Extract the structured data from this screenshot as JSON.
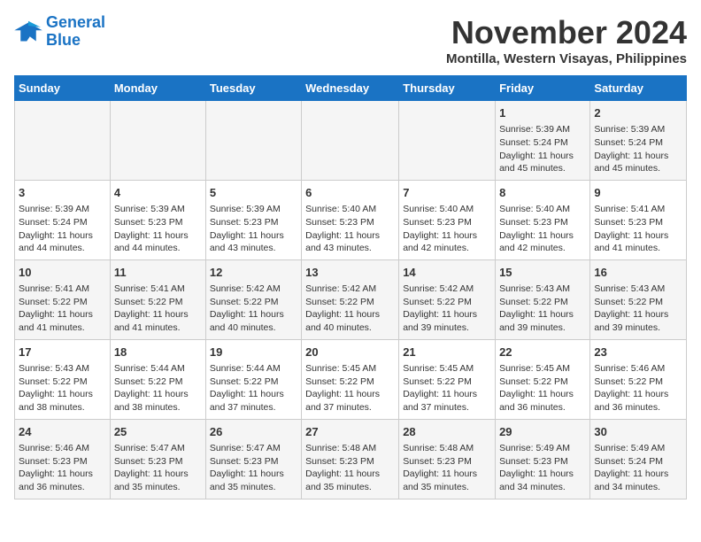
{
  "logo": {
    "line1": "General",
    "line2": "Blue"
  },
  "title": "November 2024",
  "subtitle": "Montilla, Western Visayas, Philippines",
  "headers": [
    "Sunday",
    "Monday",
    "Tuesday",
    "Wednesday",
    "Thursday",
    "Friday",
    "Saturday"
  ],
  "rows": [
    [
      {
        "day": "",
        "info": ""
      },
      {
        "day": "",
        "info": ""
      },
      {
        "day": "",
        "info": ""
      },
      {
        "day": "",
        "info": ""
      },
      {
        "day": "",
        "info": ""
      },
      {
        "day": "1",
        "info": "Sunrise: 5:39 AM\nSunset: 5:24 PM\nDaylight: 11 hours and 45 minutes."
      },
      {
        "day": "2",
        "info": "Sunrise: 5:39 AM\nSunset: 5:24 PM\nDaylight: 11 hours and 45 minutes."
      }
    ],
    [
      {
        "day": "3",
        "info": "Sunrise: 5:39 AM\nSunset: 5:24 PM\nDaylight: 11 hours and 44 minutes."
      },
      {
        "day": "4",
        "info": "Sunrise: 5:39 AM\nSunset: 5:23 PM\nDaylight: 11 hours and 44 minutes."
      },
      {
        "day": "5",
        "info": "Sunrise: 5:39 AM\nSunset: 5:23 PM\nDaylight: 11 hours and 43 minutes."
      },
      {
        "day": "6",
        "info": "Sunrise: 5:40 AM\nSunset: 5:23 PM\nDaylight: 11 hours and 43 minutes."
      },
      {
        "day": "7",
        "info": "Sunrise: 5:40 AM\nSunset: 5:23 PM\nDaylight: 11 hours and 42 minutes."
      },
      {
        "day": "8",
        "info": "Sunrise: 5:40 AM\nSunset: 5:23 PM\nDaylight: 11 hours and 42 minutes."
      },
      {
        "day": "9",
        "info": "Sunrise: 5:41 AM\nSunset: 5:23 PM\nDaylight: 11 hours and 41 minutes."
      }
    ],
    [
      {
        "day": "10",
        "info": "Sunrise: 5:41 AM\nSunset: 5:22 PM\nDaylight: 11 hours and 41 minutes."
      },
      {
        "day": "11",
        "info": "Sunrise: 5:41 AM\nSunset: 5:22 PM\nDaylight: 11 hours and 41 minutes."
      },
      {
        "day": "12",
        "info": "Sunrise: 5:42 AM\nSunset: 5:22 PM\nDaylight: 11 hours and 40 minutes."
      },
      {
        "day": "13",
        "info": "Sunrise: 5:42 AM\nSunset: 5:22 PM\nDaylight: 11 hours and 40 minutes."
      },
      {
        "day": "14",
        "info": "Sunrise: 5:42 AM\nSunset: 5:22 PM\nDaylight: 11 hours and 39 minutes."
      },
      {
        "day": "15",
        "info": "Sunrise: 5:43 AM\nSunset: 5:22 PM\nDaylight: 11 hours and 39 minutes."
      },
      {
        "day": "16",
        "info": "Sunrise: 5:43 AM\nSunset: 5:22 PM\nDaylight: 11 hours and 39 minutes."
      }
    ],
    [
      {
        "day": "17",
        "info": "Sunrise: 5:43 AM\nSunset: 5:22 PM\nDaylight: 11 hours and 38 minutes."
      },
      {
        "day": "18",
        "info": "Sunrise: 5:44 AM\nSunset: 5:22 PM\nDaylight: 11 hours and 38 minutes."
      },
      {
        "day": "19",
        "info": "Sunrise: 5:44 AM\nSunset: 5:22 PM\nDaylight: 11 hours and 37 minutes."
      },
      {
        "day": "20",
        "info": "Sunrise: 5:45 AM\nSunset: 5:22 PM\nDaylight: 11 hours and 37 minutes."
      },
      {
        "day": "21",
        "info": "Sunrise: 5:45 AM\nSunset: 5:22 PM\nDaylight: 11 hours and 37 minutes."
      },
      {
        "day": "22",
        "info": "Sunrise: 5:45 AM\nSunset: 5:22 PM\nDaylight: 11 hours and 36 minutes."
      },
      {
        "day": "23",
        "info": "Sunrise: 5:46 AM\nSunset: 5:22 PM\nDaylight: 11 hours and 36 minutes."
      }
    ],
    [
      {
        "day": "24",
        "info": "Sunrise: 5:46 AM\nSunset: 5:23 PM\nDaylight: 11 hours and 36 minutes."
      },
      {
        "day": "25",
        "info": "Sunrise: 5:47 AM\nSunset: 5:23 PM\nDaylight: 11 hours and 35 minutes."
      },
      {
        "day": "26",
        "info": "Sunrise: 5:47 AM\nSunset: 5:23 PM\nDaylight: 11 hours and 35 minutes."
      },
      {
        "day": "27",
        "info": "Sunrise: 5:48 AM\nSunset: 5:23 PM\nDaylight: 11 hours and 35 minutes."
      },
      {
        "day": "28",
        "info": "Sunrise: 5:48 AM\nSunset: 5:23 PM\nDaylight: 11 hours and 35 minutes."
      },
      {
        "day": "29",
        "info": "Sunrise: 5:49 AM\nSunset: 5:23 PM\nDaylight: 11 hours and 34 minutes."
      },
      {
        "day": "30",
        "info": "Sunrise: 5:49 AM\nSunset: 5:24 PM\nDaylight: 11 hours and 34 minutes."
      }
    ]
  ]
}
